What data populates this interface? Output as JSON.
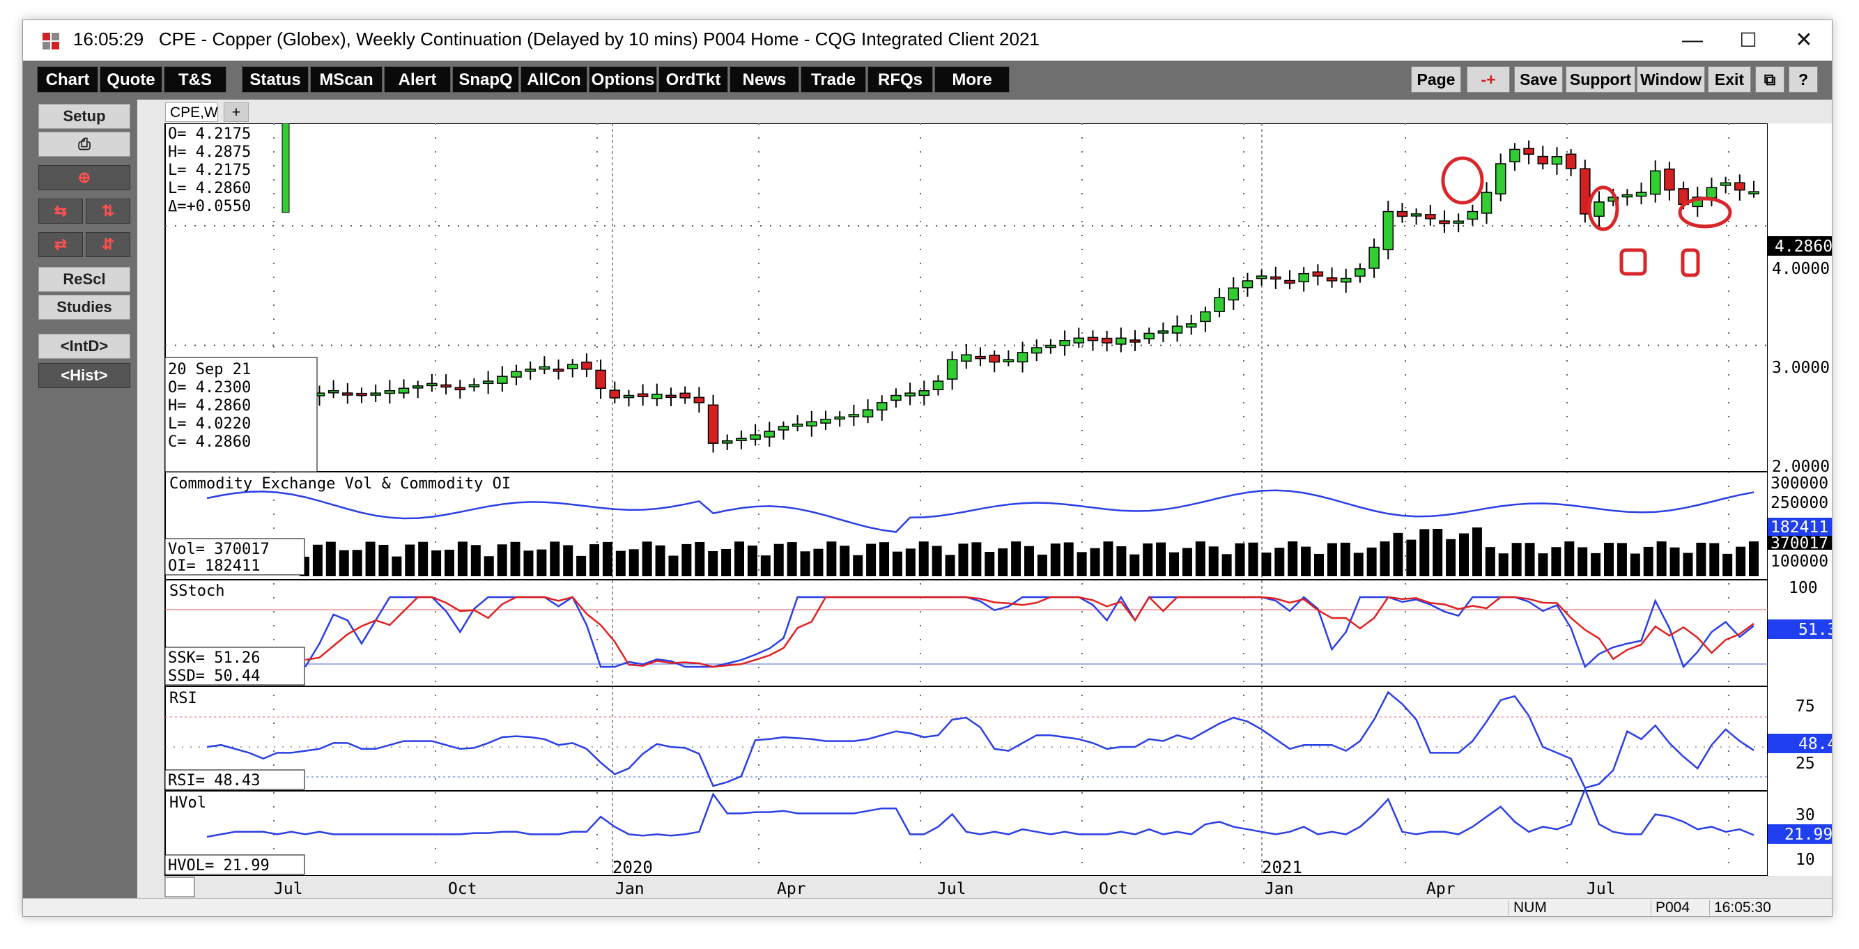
{
  "window": {
    "time": "16:05:29",
    "title": "CPE - Copper (Globex), Weekly Continuation (Delayed by 10 mins)   P004 Home - CQG Integrated Client 2021",
    "minimize": "—",
    "maximize": "☐",
    "close": "✕"
  },
  "toolbar": {
    "left": [
      "Chart",
      "Quote",
      "T&S",
      "Status",
      "MScan",
      "Alert",
      "SnapQ",
      "AllCon",
      "Options",
      "OrdTkt",
      "News",
      "Trade",
      "RFQs",
      "More"
    ],
    "right": [
      "Page",
      "-+",
      "Save",
      "Support",
      "Window",
      "Exit",
      "⧉",
      "?"
    ]
  },
  "sidebar": [
    "Setup",
    "⎙",
    "⊕",
    "⇆",
    "⇅",
    "⇄",
    "⇵",
    "ReScl",
    "Studies",
    "<IntD>",
    "<Hist>"
  ],
  "tabs": {
    "active": "CPE,W",
    "add": "+"
  },
  "price_info": {
    "o": "O= 4.2175",
    "h": "H= 4.2875",
    "l1": "L= 4.2175",
    "l2": "L= 4.2860",
    "d": "Δ=+0.0550"
  },
  "bar_info": {
    "date": "20 Sep 21",
    "o": "O=  4.2300",
    "h": "H=  4.2860",
    "l": "L=  4.0220",
    "c": "C=  4.2860"
  },
  "vol_panel": {
    "title": "Commodity Exchange Vol & Commodity OI",
    "vol": "Vol=     370017",
    "oi": "OI=      182411"
  },
  "stoch_panel": {
    "title": "SStoch",
    "ssk": "SSK=   51.26",
    "ssd": "SSD=   50.44"
  },
  "rsi_panel": {
    "title": "RSI",
    "rsi": "RSI=   48.43"
  },
  "hvol_panel": {
    "title": "HVol",
    "hvol": "HVOL=    21.99"
  },
  "axis": {
    "price": [
      "4.0000",
      "3.0000",
      "2.0000"
    ],
    "price_last": "4.2860",
    "vol": [
      "300000",
      "250000",
      "100000"
    ],
    "vol_badge1": "182411",
    "vol_badge2": "370017",
    "stoch": [
      "100"
    ],
    "stoch_last": "51.3",
    "rsi": [
      "75",
      "25"
    ],
    "rsi_last": "48.4",
    "hvol": [
      "30",
      "10"
    ],
    "hvol_last": "21.99"
  },
  "time_axis": [
    "Jul",
    "Oct",
    "Jan",
    "Apr",
    "Jul",
    "Oct",
    "Jan",
    "Apr",
    "Jul"
  ],
  "year_labels": [
    "2020",
    "2021"
  ],
  "status": {
    "num": "NUM",
    "page": "P004",
    "time": "16:05:30"
  },
  "colors": {
    "up": "#32cd32",
    "down": "#d42020",
    "line": "#2a3fe6",
    "stoch_d": "#e02020",
    "badge": "#1f3ff0",
    "circle": "#d8262a"
  },
  "chart_data": {
    "type": "candlestick",
    "title": "CPE - Copper (Globex), Weekly Continuation",
    "x_range": [
      "2019-06",
      "2021-09"
    ],
    "y_range": [
      2.0,
      4.8
    ],
    "close": [
      2.7,
      2.72,
      2.68,
      2.64,
      2.6,
      2.62,
      2.58,
      2.56,
      2.6,
      2.62,
      2.6,
      2.58,
      2.6,
      2.62,
      2.64,
      2.66,
      2.68,
      2.66,
      2.64,
      2.67,
      2.7,
      2.74,
      2.78,
      2.8,
      2.82,
      2.8,
      2.84,
      2.8,
      2.64,
      2.56,
      2.58,
      2.57,
      2.59,
      2.58,
      2.56,
      2.52,
      2.18,
      2.2,
      2.22,
      2.25,
      2.28,
      2.32,
      2.34,
      2.36,
      2.38,
      2.4,
      2.42,
      2.46,
      2.52,
      2.58,
      2.6,
      2.62,
      2.7,
      2.88,
      2.92,
      2.9,
      2.86,
      2.88,
      2.94,
      2.98,
      3.0,
      3.04,
      3.06,
      3.04,
      3.02,
      3.06,
      3.04,
      3.1,
      3.12,
      3.16,
      3.18,
      3.28,
      3.4,
      3.48,
      3.54,
      3.58,
      3.56,
      3.52,
      3.6,
      3.58,
      3.54,
      3.56,
      3.64,
      3.82,
      4.12,
      4.08,
      4.1,
      4.06,
      4.02,
      4.04,
      4.12,
      4.28,
      4.52,
      4.64,
      4.6,
      4.52,
      4.58,
      4.48,
      4.1,
      4.2,
      4.24,
      4.26,
      4.28,
      4.46,
      4.3,
      4.18,
      4.24,
      4.32,
      4.36,
      4.3,
      4.286
    ],
    "annotations": [
      "highs circled",
      "lows boxed"
    ]
  }
}
